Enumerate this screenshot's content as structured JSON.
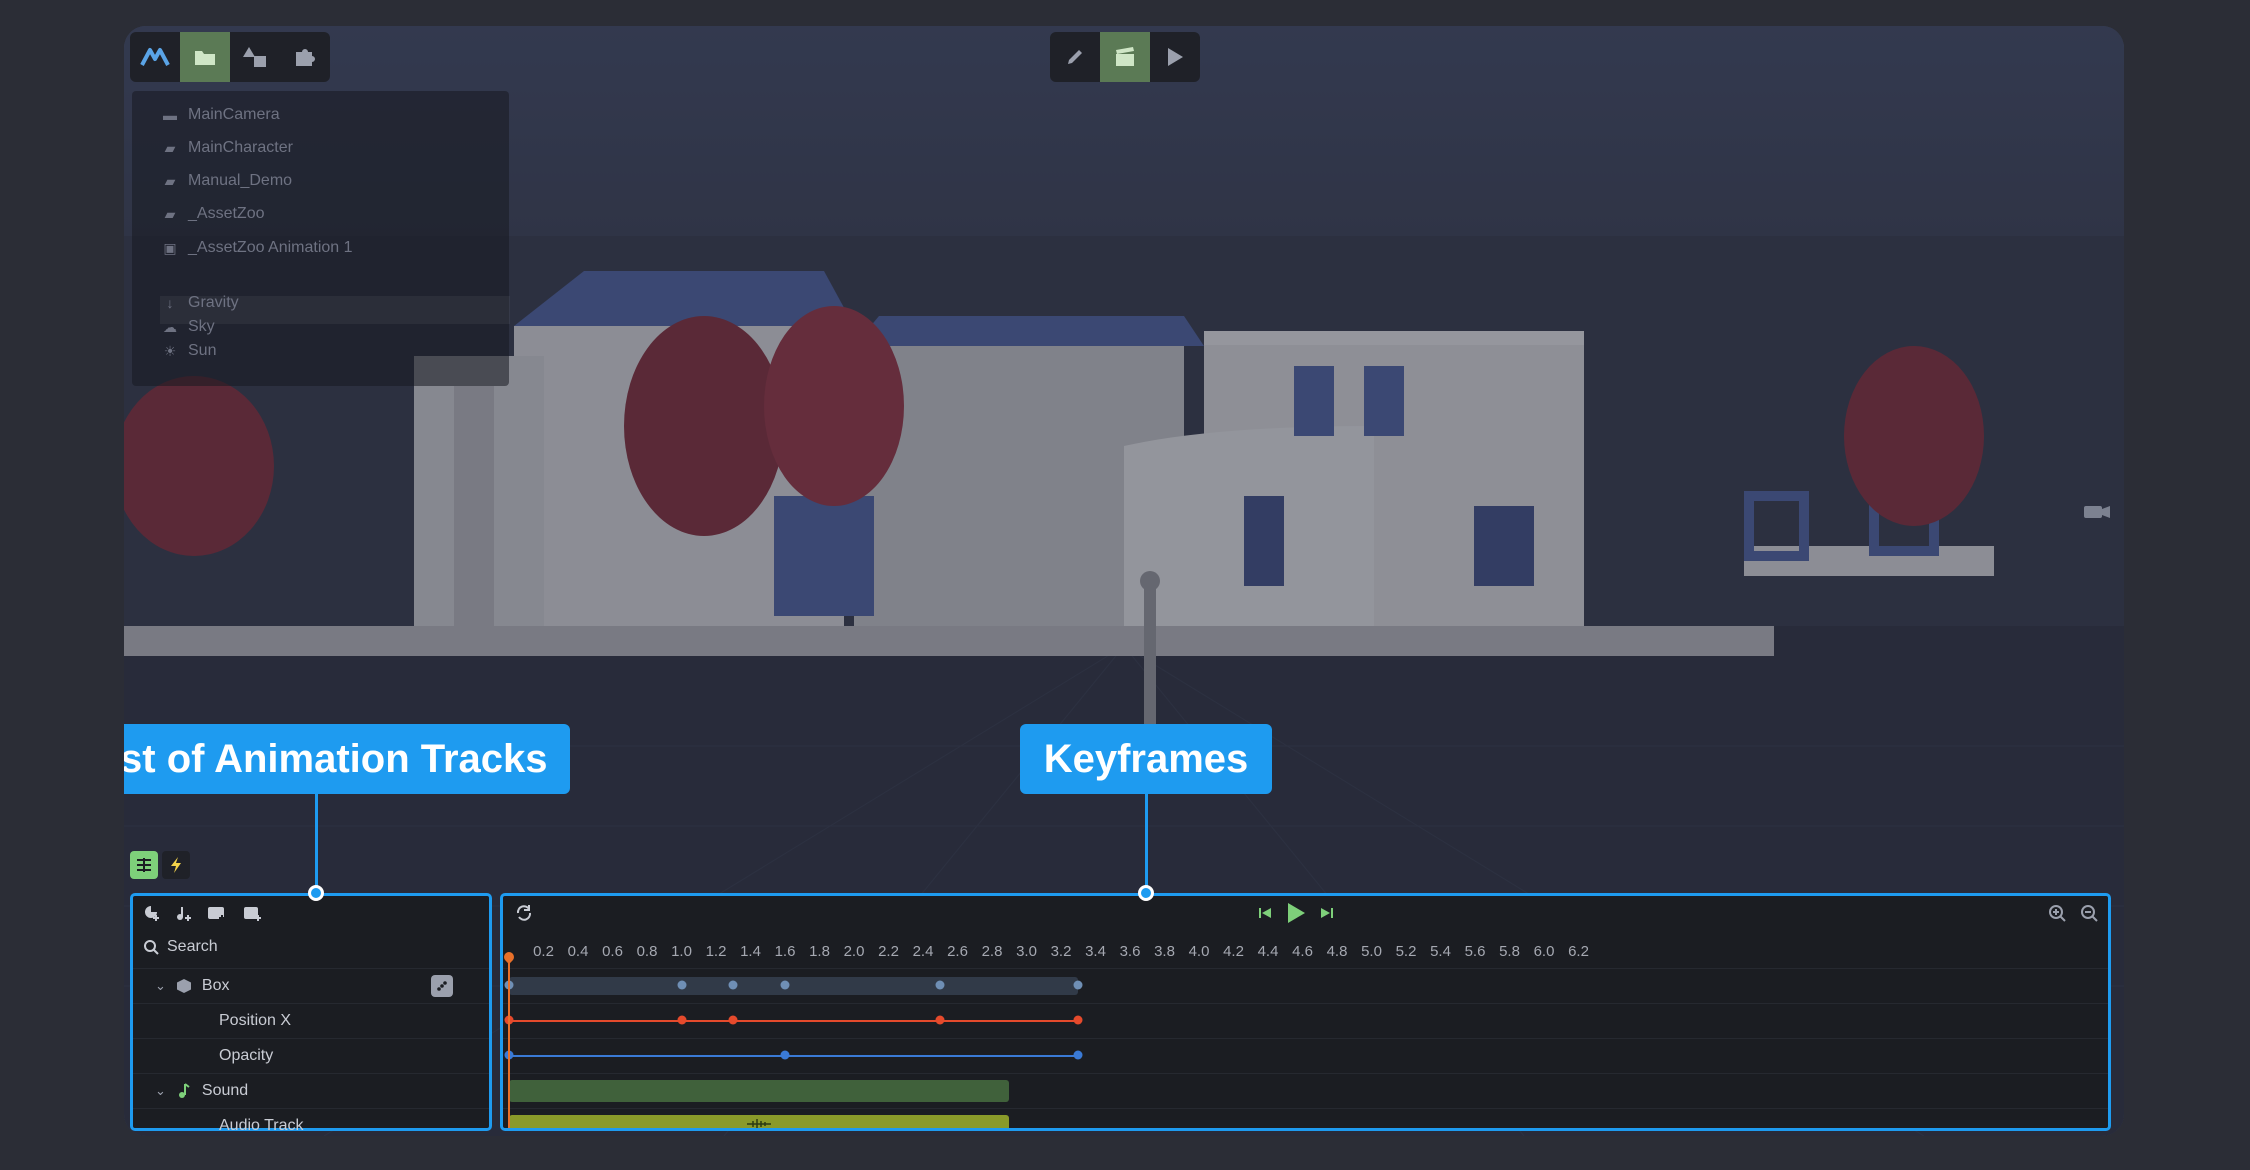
{
  "colors": {
    "accent": "#1e9bf0",
    "active_green": "#5b7a55",
    "posx_line": "#e54a2c",
    "opacity_line": "#3a7ad6",
    "box_bar": "#313a48",
    "box_key": "#6f8fb5",
    "sound_bar": "#40613b",
    "audio_bar": "#8a9a2a",
    "playhead": "#e8702a"
  },
  "top_toolbar_left": {
    "icons": [
      "logo-icon",
      "folder-icon",
      "shapes-icon",
      "puzzle-icon"
    ]
  },
  "top_toolbar_center": {
    "icons": [
      "pencil-icon",
      "clapperboard-icon",
      "play-icon"
    ]
  },
  "outliner": {
    "items": [
      {
        "label": "MainCamera",
        "icon": "camera-icon"
      },
      {
        "label": "MainCharacter",
        "icon": "folder-icon"
      },
      {
        "label": "Manual_Demo",
        "icon": "folder-icon"
      },
      {
        "label": "_AssetZoo",
        "icon": "folder-icon"
      },
      {
        "label": "_AssetZoo Animation 1",
        "icon": "animation-icon"
      },
      {
        "label": "Gravity",
        "icon": "gravity-icon"
      },
      {
        "label": "Sky",
        "icon": "cloud-icon"
      },
      {
        "label": "Sun",
        "icon": "sun-icon"
      }
    ]
  },
  "callouts": {
    "tracks": "List of Animation Tracks",
    "keyframes": "Keyframes"
  },
  "tracks_panel": {
    "search_placeholder": "Search",
    "rows": [
      {
        "label": "Box",
        "icon": "cube-icon",
        "level": 0
      },
      {
        "label": "Position X",
        "level": 1
      },
      {
        "label": "Opacity",
        "level": 1
      },
      {
        "label": "Sound",
        "icon": "music-note-icon",
        "level": 0
      },
      {
        "label": "Audio Track",
        "level": 1
      }
    ]
  },
  "timeline": {
    "ticks": [
      "0.2",
      "0.4",
      "0.6",
      "0.8",
      "1.0",
      "1.2",
      "1.4",
      "1.6",
      "1.8",
      "2.0",
      "2.2",
      "2.4",
      "2.6",
      "2.8",
      "3.0",
      "3.2",
      "3.4",
      "3.6",
      "3.8",
      "4.0",
      "4.2",
      "4.4",
      "4.6",
      "4.8",
      "5.0",
      "5.2",
      "5.4",
      "5.6",
      "5.8",
      "6.0",
      "6.2"
    ],
    "box_keys": [
      0,
      1.0,
      1.3,
      1.6,
      2.5,
      3.3
    ],
    "posx_keys": [
      0,
      1.0,
      1.3,
      2.5,
      3.3
    ],
    "opacity_keys": [
      0,
      1.6,
      3.3
    ],
    "sound_end": 2.9,
    "audio_end": 2.9,
    "playhead": 0
  }
}
